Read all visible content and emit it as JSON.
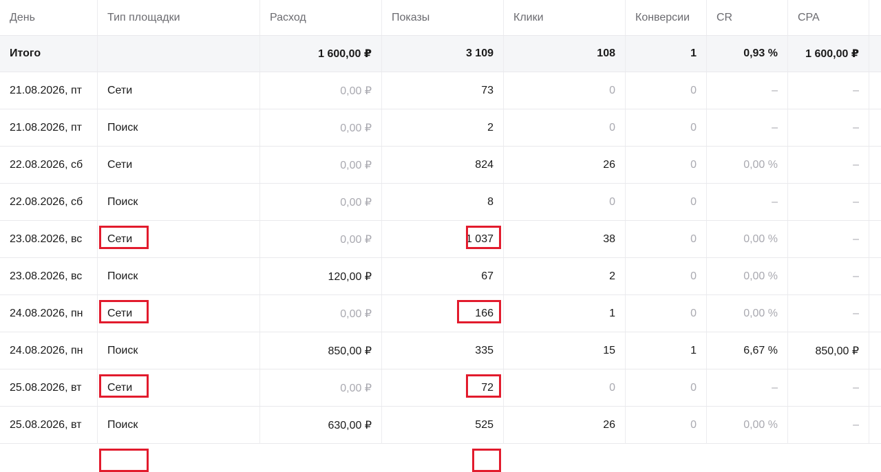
{
  "columns": [
    "День",
    "Тип площадки",
    "Расход",
    "Показы",
    "Клики",
    "Конверсии",
    "CR",
    "CPA"
  ],
  "total": {
    "day": "Итого",
    "type": "",
    "spend": "1 600,00 ₽",
    "impressions": "3 109",
    "clicks": "108",
    "conversions": "1",
    "cr": "0,93 %",
    "cpa": "1 600,00 ₽"
  },
  "rows": [
    {
      "day": "21.08.2026, пт",
      "type": "Сети",
      "spend": "0,00 ₽",
      "impressions": "73",
      "clicks": "0",
      "conversions": "0",
      "cr": "–",
      "cpa": "–",
      "highlighted": false
    },
    {
      "day": "21.08.2026, пт",
      "type": "Поиск",
      "spend": "0,00 ₽",
      "impressions": "2",
      "clicks": "0",
      "conversions": "0",
      "cr": "–",
      "cpa": "–",
      "highlighted": false
    },
    {
      "day": "22.08.2026, сб",
      "type": "Сети",
      "spend": "0,00 ₽",
      "impressions": "824",
      "clicks": "26",
      "conversions": "0",
      "cr": "0,00 %",
      "cpa": "–",
      "highlighted": true
    },
    {
      "day": "22.08.2026, сб",
      "type": "Поиск",
      "spend": "0,00 ₽",
      "impressions": "8",
      "clicks": "0",
      "conversions": "0",
      "cr": "–",
      "cpa": "–",
      "highlighted": false
    },
    {
      "day": "23.08.2026, вс",
      "type": "Сети",
      "spend": "0,00 ₽",
      "impressions": "1 037",
      "clicks": "38",
      "conversions": "0",
      "cr": "0,00 %",
      "cpa": "–",
      "highlighted": true
    },
    {
      "day": "23.08.2026, вс",
      "type": "Поиск",
      "spend": "120,00 ₽",
      "impressions": "67",
      "clicks": "2",
      "conversions": "0",
      "cr": "0,00 %",
      "cpa": "–",
      "highlighted": false
    },
    {
      "day": "24.08.2026, пн",
      "type": "Сети",
      "spend": "0,00 ₽",
      "impressions": "166",
      "clicks": "1",
      "conversions": "0",
      "cr": "0,00 %",
      "cpa": "–",
      "highlighted": true
    },
    {
      "day": "24.08.2026, пн",
      "type": "Поиск",
      "spend": "850,00 ₽",
      "impressions": "335",
      "clicks": "15",
      "conversions": "1",
      "cr": "6,67 %",
      "cpa": "850,00 ₽",
      "highlighted": false
    },
    {
      "day": "25.08.2026, вт",
      "type": "Сети",
      "spend": "0,00 ₽",
      "impressions": "72",
      "clicks": "0",
      "conversions": "0",
      "cr": "–",
      "cpa": "–",
      "highlighted": true
    },
    {
      "day": "25.08.2026, вт",
      "type": "Поиск",
      "spend": "630,00 ₽",
      "impressions": "525",
      "clicks": "26",
      "conversions": "0",
      "cr": "0,00 %",
      "cpa": "–",
      "highlighted": false
    }
  ],
  "colors": {
    "highlight": "#e21b2d",
    "muted_text": "#a9a9b0",
    "header_text": "#6b6b70",
    "total_row_bg": "#f5f6f8"
  }
}
